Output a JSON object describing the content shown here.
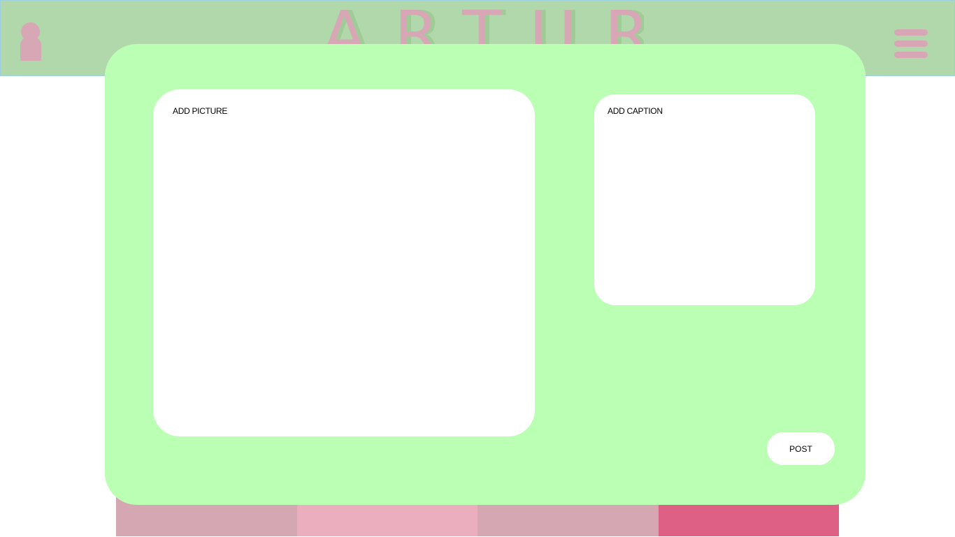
{
  "header": {
    "logo_text": "ARTUR",
    "background": "#b0d8ab",
    "accent": "#d8a7b5"
  },
  "icons": {
    "avatar": "user-avatar-icon",
    "menu": "hamburger-menu-icon"
  },
  "modal": {
    "background": "#bbffb4",
    "picture_label": "ADD PICTURE",
    "caption_label": "ADD CAPTION",
    "post_label": "POST"
  },
  "bottom_strip": {
    "colors": [
      "#d5a7b2",
      "#eaaebe",
      "#d5a7b2",
      "#de6085"
    ]
  }
}
